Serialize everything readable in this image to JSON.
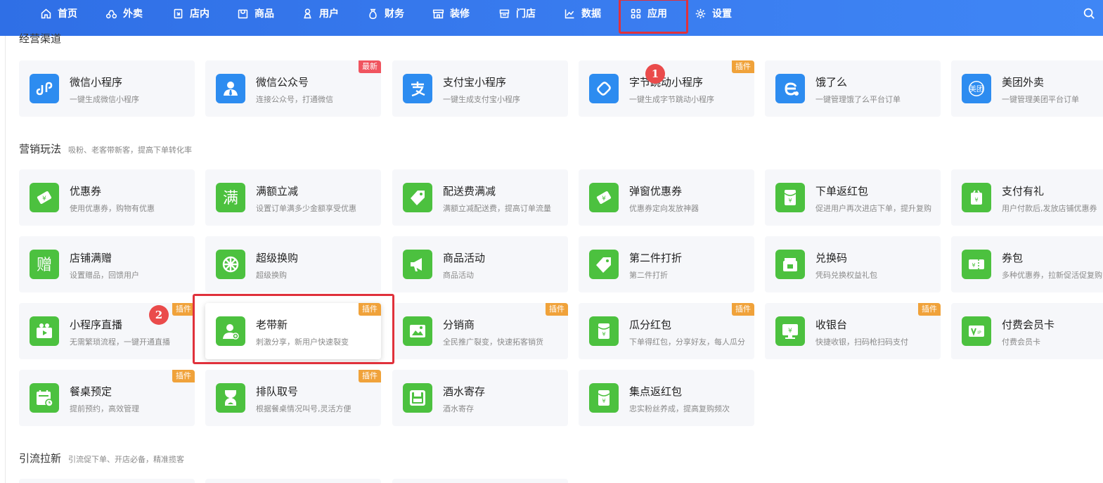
{
  "nav": {
    "items": [
      {
        "label": "首页",
        "icon": "home-icon"
      },
      {
        "label": "外卖",
        "icon": "scooter-icon"
      },
      {
        "label": "店内",
        "icon": "store-in-icon"
      },
      {
        "label": "商品",
        "icon": "bag-icon"
      },
      {
        "label": "用户",
        "icon": "user-icon"
      },
      {
        "label": "财务",
        "icon": "money-bag-icon"
      },
      {
        "label": "装修",
        "icon": "shop-front-icon"
      },
      {
        "label": "门店",
        "icon": "storefront-icon"
      },
      {
        "label": "数据",
        "icon": "line-chart-icon"
      },
      {
        "label": "应用",
        "icon": "apps-grid-icon"
      },
      {
        "label": "设置",
        "icon": "gear-icon"
      }
    ]
  },
  "sections": [
    {
      "name": "经营渠道",
      "desc": ""
    },
    {
      "name": "营销玩法",
      "desc": "吸粉、老客带新客，提高下单转化率"
    },
    {
      "name": "引流拉新",
      "desc": "引流促下单、开店必备，精准揽客"
    }
  ],
  "channels": [
    {
      "title": "微信小程序",
      "desc": "一键生成微信小程序",
      "tag": "",
      "icon": "mini-program-icon"
    },
    {
      "title": "微信公众号",
      "desc": "连接公众号，打通微信",
      "tag": "最新",
      "icon": "official-account-icon"
    },
    {
      "title": "支付宝小程序",
      "desc": "一键生成支付宝小程序",
      "tag": "",
      "icon": "alipay-icon"
    },
    {
      "title": "字节跳动小程序",
      "desc": "一键生成字节跳动小程序",
      "tag": "插件",
      "icon": "bytedance-icon"
    },
    {
      "title": "饿了么",
      "desc": "一键管理饿了么平台订单",
      "tag": "",
      "icon": "eleme-icon"
    },
    {
      "title": "美团外卖",
      "desc": "一键管理美团平台订单",
      "tag": "",
      "icon": "meituan-icon"
    }
  ],
  "marketing": [
    {
      "title": "优惠券",
      "desc": "使用优惠券，购物有优惠",
      "tag": "",
      "icon": "coupon-icon"
    },
    {
      "title": "满额立减",
      "desc": "设置订单满多少金额享受优惠",
      "tag": "",
      "icon": "full-reduce-icon"
    },
    {
      "title": "配送费满减",
      "desc": "满额立减配送费，提高订单流量",
      "tag": "",
      "icon": "price-tag-icon"
    },
    {
      "title": "弹窗优惠券",
      "desc": "优惠券定向发放神器",
      "tag": "",
      "icon": "popup-coupon-icon"
    },
    {
      "title": "下单返红包",
      "desc": "促进用户再次进店下单，提升复购",
      "tag": "",
      "icon": "red-packet-icon"
    },
    {
      "title": "支付有礼",
      "desc": "用户付款后,发放店铺优惠券",
      "tag": "",
      "icon": "gift-icon"
    },
    {
      "title": "店铺满赠",
      "desc": "设置赠品，回馈用户",
      "tag": "",
      "icon": "full-gift-icon"
    },
    {
      "title": "超级换购",
      "desc": "超级换购",
      "tag": "",
      "icon": "wheel-icon"
    },
    {
      "title": "商品活动",
      "desc": "商品活动",
      "tag": "",
      "icon": "megaphone-icon"
    },
    {
      "title": "第二件打折",
      "desc": "第二件打折",
      "tag": "",
      "icon": "discount-tag-icon"
    },
    {
      "title": "兑换码",
      "desc": "凭码兑换权益礼包",
      "tag": "",
      "icon": "redeem-code-icon"
    },
    {
      "title": "券包",
      "desc": "多种优惠券，拉新促活促复购",
      "tag": "",
      "icon": "coupon-pack-icon"
    },
    {
      "title": "小程序直播",
      "desc": "无需繁琐流程，一键开通直播",
      "tag": "插件",
      "icon": "live-video-icon"
    },
    {
      "title": "老带新",
      "desc": "刺激分享，新用户快速裂变",
      "tag": "插件",
      "icon": "invite-user-icon"
    },
    {
      "title": "分销商",
      "desc": "全民推广裂变，快速拓客销货",
      "tag": "插件",
      "icon": "image-icon"
    },
    {
      "title": "瓜分红包",
      "desc": "下单得红包，分享好友，每人瓜分",
      "tag": "插件",
      "icon": "split-red-packet-icon"
    },
    {
      "title": "收银台",
      "desc": "快捷收银，扫码枪扫码支付",
      "tag": "插件",
      "icon": "cashier-icon"
    },
    {
      "title": "付费会员卡",
      "desc": "付费会员卡",
      "tag": "",
      "icon": "vip-card-icon"
    },
    {
      "title": "餐桌预定",
      "desc": "提前预约，高效管理",
      "tag": "插件",
      "icon": "calendar-icon"
    },
    {
      "title": "排队取号",
      "desc": "根据餐桌情况叫号,灵活方便",
      "tag": "插件",
      "icon": "hourglass-icon"
    },
    {
      "title": "酒水寄存",
      "desc": "酒水寄存",
      "tag": "",
      "icon": "storage-icon"
    },
    {
      "title": "集点返红包",
      "desc": "忠实粉丝养成，提高复购频次",
      "tag": "",
      "icon": "points-red-packet-icon"
    }
  ],
  "annotations": {
    "step1": "1",
    "step2": "2"
  },
  "colors": {
    "nav": "#3a7df0",
    "green_icon": "#4cc13f",
    "blue_icon": "#2d8cf0",
    "plugin_tag": "#f0a23a",
    "newest_tag": "#f0545f",
    "highlight": "#e0313b"
  }
}
